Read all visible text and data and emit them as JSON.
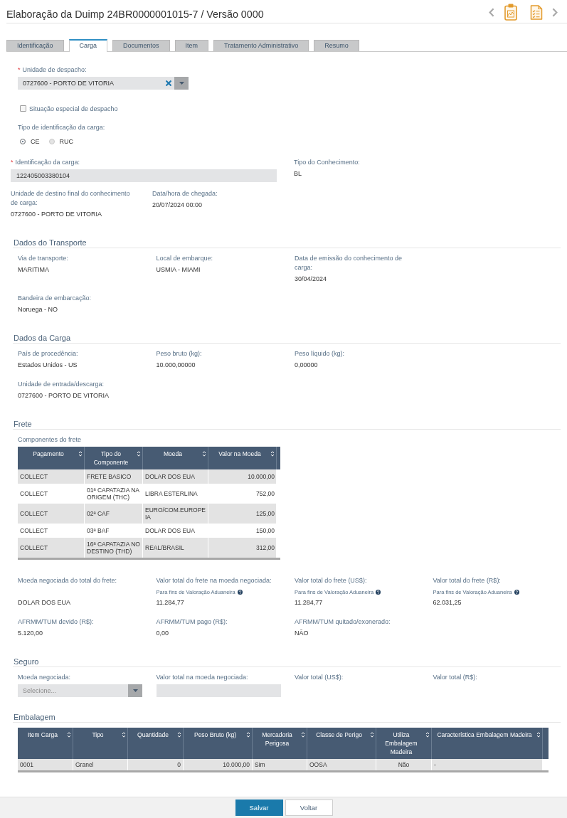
{
  "header": {
    "title": "Elaboração da Duimp 24BR0000001015-7 / Versão 0000"
  },
  "tabs": [
    {
      "label": "Identificação",
      "selected": false
    },
    {
      "label": "Carga",
      "selected": true
    },
    {
      "label": "Documentos",
      "selected": false
    },
    {
      "label": "Item",
      "selected": false
    },
    {
      "label": "Tratamento Administrativo",
      "selected": false
    },
    {
      "label": "Resumo",
      "selected": false
    }
  ],
  "despacho": {
    "unidade": {
      "required_mark": "*",
      "label": "Unidade de despacho:",
      "value": "0727600 - PORTO DE VITORIA"
    },
    "situacao_especial": {
      "label": "Situação especial de despacho",
      "checked": false
    },
    "tipo_identificacao": {
      "label": "Tipo de identificação da carga:",
      "options": [
        {
          "label": "CE",
          "selected": true
        },
        {
          "label": "RUC",
          "selected": false
        }
      ]
    }
  },
  "carga": {
    "rows": [
      [
        {
          "kind": "input",
          "required_mark": "*",
          "label": "Identificação da carga:",
          "value": "122405003380104"
        },
        {
          "kind": "text",
          "label": "Tipo do Conhecimento:",
          "value": "BL"
        }
      ],
      [
        {
          "kind": "text",
          "label": "Unidade de destino final do conhecimento de carga:",
          "value": "0727600 - PORTO DE VITORIA"
        },
        {
          "kind": "text",
          "label": "Data/hora de chegada:",
          "value": "20/07/2024 00:00"
        }
      ]
    ]
  },
  "sections": [
    {
      "title": "Dados do Transporte",
      "rows": [
        [
          {
            "kind": "text",
            "label": "Via de transporte:",
            "value": "MARITIMA"
          },
          {
            "kind": "text",
            "label": "Local de embarque:",
            "value": "USMIA - MIAMI"
          },
          {
            "kind": "text",
            "label": "Data de emissão do conhecimento de carga:",
            "value": "30/04/2024"
          }
        ],
        [
          {
            "kind": "text",
            "label": "Bandeira de embarcação:",
            "value": "Noruega - NO"
          }
        ]
      ]
    },
    {
      "title": "Dados da Carga",
      "rows": [
        [
          {
            "kind": "text",
            "label": "País de procedência:",
            "value": "Estados Unidos - US"
          },
          {
            "kind": "text",
            "label": "Peso bruto (kg):",
            "value": "10.000,00000"
          },
          {
            "kind": "text",
            "label": "Peso líquido (kg):",
            "value": "0,00000"
          }
        ],
        [
          {
            "kind": "text",
            "label": "Unidade de entrada/descarga:",
            "value": "0727600 - PORTO DE VITORIA"
          }
        ]
      ]
    },
    {
      "title": "Frete",
      "table": {
        "caption": "Componentes do frete",
        "columns": [
          {
            "label": "Pagamento",
            "kind": "text"
          },
          {
            "label": "Tipo do Componente",
            "kind": "text"
          },
          {
            "label": "Moeda",
            "kind": "text"
          },
          {
            "label": "Valor na Moeda",
            "kind": "number"
          }
        ],
        "rows": [
          [
            "COLLECT",
            "FRETE BASICO",
            "DOLAR DOS EUA",
            "10.000,00"
          ],
          [
            "COLLECT",
            "01ª CAPATAZIA NA ORIGEM (THC)",
            "LIBRA ESTERLINA",
            "752,00"
          ],
          [
            "COLLECT",
            "02ª CAF",
            "EURO/COM.EUROPEIA",
            "125,00"
          ],
          [
            "COLLECT",
            "03ª BAF",
            "DOLAR DOS EUA",
            "150,00"
          ],
          [
            "COLLECT",
            "16ª CAPATAZIA NO DESTINO (THD)",
            "REAL/BRASIL",
            "312,00"
          ]
        ]
      },
      "rows": [
        [
          {
            "kind": "text",
            "label": "Moeda negociada do total do frete:",
            "value": "DOLAR DOS EUA"
          },
          {
            "kind": "text",
            "label": "Valor total do frete na moeda negociada:",
            "note": "Para fins de Valoração Aduaneira",
            "value": "11.284,77"
          },
          {
            "kind": "text",
            "label": "Valor total do frete (US$):",
            "note": "Para fins de Valoração Aduaneira",
            "value": "11.284,77"
          },
          {
            "kind": "text",
            "label": "Valor total do frete (R$):",
            "note": "Para fins de Valoração Aduaneira",
            "value": "62.031,25"
          }
        ],
        [
          {
            "kind": "text",
            "label": "AFRMM/TUM devido (R$):",
            "value": "5.120,00"
          },
          {
            "kind": "text",
            "label": "AFRMM/TUM pago (R$):",
            "value": "0,00"
          },
          {
            "kind": "text",
            "label": "AFRMM/TUM quitado/exonerado:",
            "value": "NÃO"
          }
        ]
      ]
    },
    {
      "title": "Seguro",
      "rows": [
        [
          {
            "kind": "select",
            "label": "Moeda negociada:",
            "placeholder": "Selecione..."
          },
          {
            "kind": "input",
            "label": "Valor total na moeda negociada:"
          },
          {
            "kind": "text",
            "label": "Valor total (US$):"
          },
          {
            "kind": "text",
            "label": "Valor total (R$):"
          }
        ]
      ]
    },
    {
      "title": "Embalagem",
      "table": {
        "columns": [
          {
            "label": "Item Carga",
            "kind": "text"
          },
          {
            "label": "Tipo",
            "kind": "text"
          },
          {
            "label": "Quantidade",
            "kind": "number"
          },
          {
            "label": "Peso Bruto (kg)",
            "kind": "number"
          },
          {
            "label": "Mercadoria Perigosa",
            "kind": "text"
          },
          {
            "label": "Classe de Perigo",
            "kind": "text"
          },
          {
            "label": "Utiliza Embalagem Madeira",
            "kind": "flag"
          },
          {
            "label": "Característica Embalagem Madeira",
            "kind": "text"
          }
        ],
        "rows": [
          [
            "0001",
            "Granel",
            "0",
            "10.000,00",
            "Sim",
            "OOSA",
            "Não",
            "-"
          ]
        ]
      }
    }
  ],
  "actions": [
    {
      "label": "Salvar",
      "kind": "primary"
    },
    {
      "label": "Voltar",
      "kind": "secondary"
    }
  ]
}
